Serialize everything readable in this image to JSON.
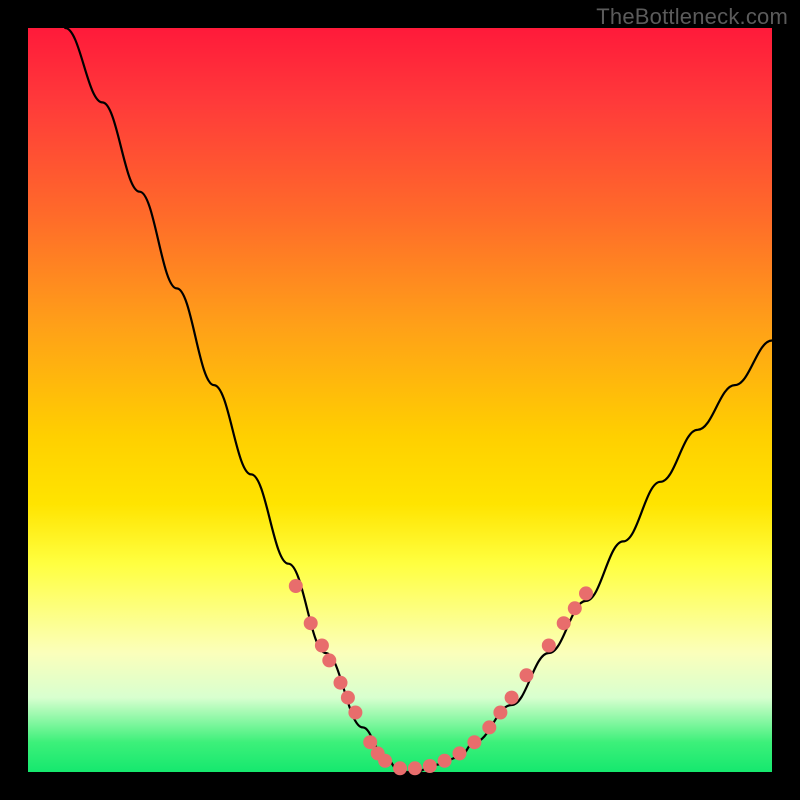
{
  "watermark": "TheBottleneck.com",
  "chart_data": {
    "type": "line",
    "title": "",
    "xlabel": "",
    "ylabel": "",
    "xlim": [
      0,
      100
    ],
    "ylim": [
      0,
      100
    ],
    "grid": false,
    "legend": false,
    "series": [
      {
        "name": "bottleneck-curve",
        "x": [
          5,
          10,
          15,
          20,
          25,
          30,
          35,
          40,
          45,
          48,
          50,
          52,
          55,
          58,
          60,
          65,
          70,
          75,
          80,
          85,
          90,
          95,
          100
        ],
        "y": [
          100,
          90,
          78,
          65,
          52,
          40,
          28,
          16,
          6,
          2,
          0,
          0,
          1,
          2,
          4,
          9,
          16,
          23,
          31,
          39,
          46,
          52,
          58
        ]
      }
    ],
    "markers": [
      {
        "x": 36,
        "y": 25
      },
      {
        "x": 38,
        "y": 20
      },
      {
        "x": 39.5,
        "y": 17
      },
      {
        "x": 40.5,
        "y": 15
      },
      {
        "x": 42,
        "y": 12
      },
      {
        "x": 43,
        "y": 10
      },
      {
        "x": 44,
        "y": 8
      },
      {
        "x": 46,
        "y": 4
      },
      {
        "x": 47,
        "y": 2.5
      },
      {
        "x": 48,
        "y": 1.5
      },
      {
        "x": 50,
        "y": 0.5
      },
      {
        "x": 52,
        "y": 0.5
      },
      {
        "x": 54,
        "y": 0.8
      },
      {
        "x": 56,
        "y": 1.5
      },
      {
        "x": 58,
        "y": 2.5
      },
      {
        "x": 60,
        "y": 4
      },
      {
        "x": 62,
        "y": 6
      },
      {
        "x": 63.5,
        "y": 8
      },
      {
        "x": 65,
        "y": 10
      },
      {
        "x": 67,
        "y": 13
      },
      {
        "x": 70,
        "y": 17
      },
      {
        "x": 72,
        "y": 20
      },
      {
        "x": 73.5,
        "y": 22
      },
      {
        "x": 75,
        "y": 24
      }
    ],
    "marker_style": {
      "color": "#e86d6c",
      "radius_px": 7
    }
  }
}
